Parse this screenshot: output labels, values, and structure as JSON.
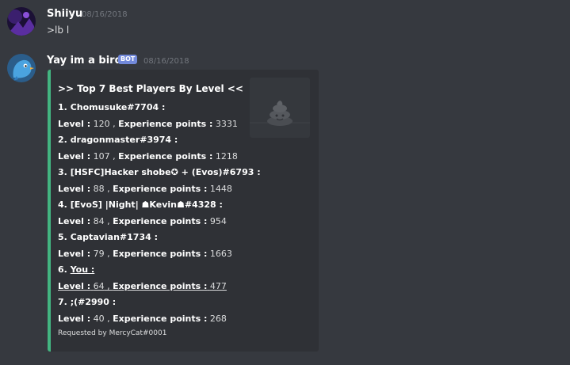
{
  "messages": [
    {
      "username": "Shiiyu",
      "timestamp": "08/16/2018",
      "content": ">lb l"
    },
    {
      "username": "Yay im a birdo",
      "badge": "BOT",
      "timestamp": "08/16/2018"
    }
  ],
  "embed": {
    "accent_color": "#43b581",
    "title": ">> Top 7 Best Players By Level <<",
    "level_label": "Level :",
    "xp_label": "Experience points :",
    "entries": [
      {
        "rank": "1.",
        "name": "Chomusuke#7704 :",
        "level": "120",
        "xp": "3331"
      },
      {
        "rank": "2.",
        "name": "dragonmaster#3974 :",
        "level": "107",
        "xp": "1218"
      },
      {
        "rank": "3.",
        "name": "[HSFC]Hacker shobe✪ + (Evos)#6793 :",
        "level": "88",
        "xp": "1448"
      },
      {
        "rank": "4.",
        "name": "[EvoS] |Night| ☗Kevin☗#4328 :",
        "level": "84",
        "xp": "954"
      },
      {
        "rank": "5.",
        "name": "Captavian#1734 :",
        "level": "79",
        "xp": "1663"
      },
      {
        "rank": "6.",
        "name": "You :",
        "level": "64",
        "xp": "477"
      },
      {
        "rank": "7.",
        "name": ";(#2990 :",
        "level": "40",
        "xp": "268"
      }
    ],
    "footer": "Requested by MercyCat#0001",
    "thumbnail_icon": "poop-icon"
  }
}
